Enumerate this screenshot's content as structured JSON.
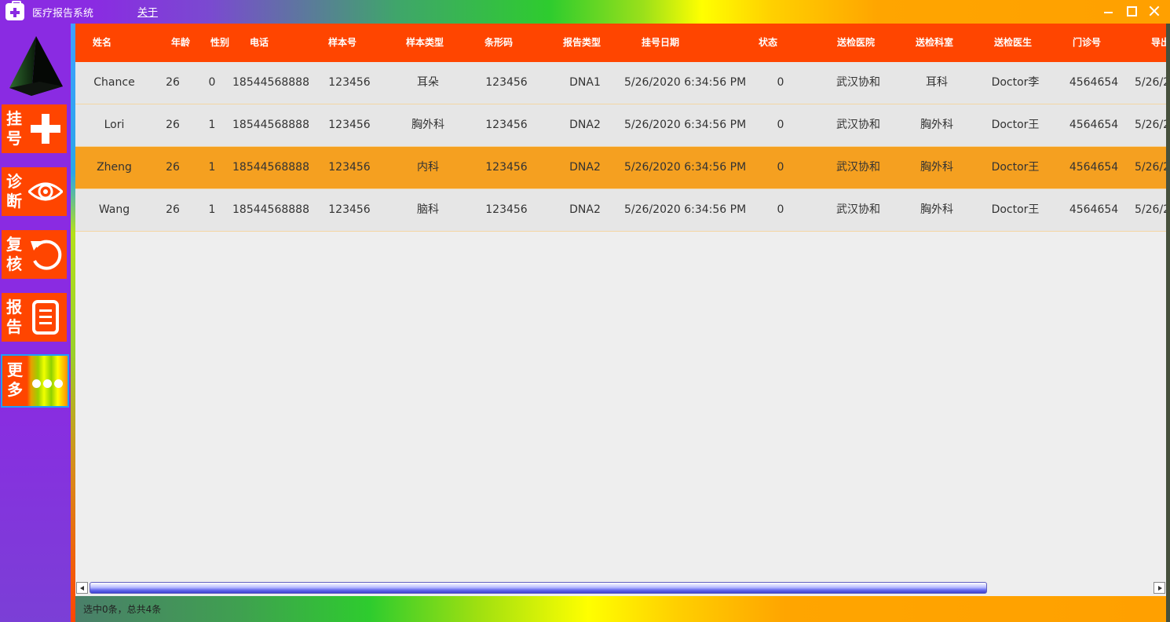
{
  "window": {
    "title": "医疗报告系统",
    "menu_about": "关于"
  },
  "sidebar": {
    "logo_icon": "cone-icon",
    "items": [
      {
        "label": "挂号",
        "icon": "plus-icon"
      },
      {
        "label": "诊断",
        "icon": "eye-icon"
      },
      {
        "label": "复核",
        "icon": "undo-icon"
      },
      {
        "label": "报告",
        "icon": "document-icon"
      },
      {
        "label": "更多",
        "icon": "more-dots-icon"
      }
    ]
  },
  "table": {
    "columns": [
      "姓名",
      "年龄",
      "性别",
      "电话",
      "样本号",
      "样本类型",
      "条形码",
      "报告类型",
      "挂号日期",
      "状态",
      "送检医院",
      "送检科室",
      "送检医生",
      "门诊号",
      "导出"
    ],
    "rows": [
      [
        "Chance",
        "26",
        "0",
        "18544568888",
        "123456",
        "耳朵",
        "123456",
        "DNA1",
        "5/26/2020 6:34:56 PM",
        "0",
        "武汉协和",
        "耳科",
        "Doctor李",
        "4564654",
        "5/26/2"
      ],
      [
        "Lori",
        "26",
        "1",
        "18544568888",
        "123456",
        "胸外科",
        "123456",
        "DNA2",
        "5/26/2020 6:34:56 PM",
        "0",
        "武汉协和",
        "胸外科",
        "Doctor王",
        "4564654",
        "5/26/2"
      ],
      [
        "Zheng",
        "26",
        "1",
        "18544568888",
        "123456",
        "内科",
        "123456",
        "DNA2",
        "5/26/2020 6:34:56 PM",
        "0",
        "武汉协和",
        "胸外科",
        "Doctor王",
        "4564654",
        "5/26/2"
      ],
      [
        "Wang",
        "26",
        "1",
        "18544568888",
        "123456",
        "脑科",
        "123456",
        "DNA2",
        "5/26/2020 6:34:56 PM",
        "0",
        "武汉协和",
        "胸外科",
        "Doctor王",
        "4564654",
        "5/26/2"
      ]
    ],
    "selected_row": 2
  },
  "statusbar": {
    "text": "选中0条，总共4条"
  },
  "colors": {
    "header": "#ff4500",
    "selected_row": "#f5a020",
    "sidebar": "#8a2be2"
  }
}
